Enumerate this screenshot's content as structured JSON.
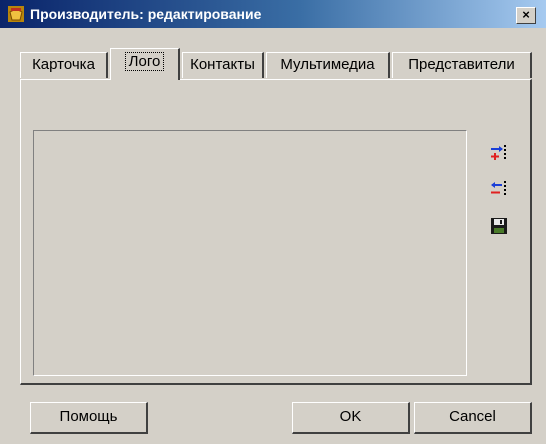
{
  "window": {
    "title": "Производитель: редактирование",
    "close_label": "×"
  },
  "tabs": [
    {
      "label": "Карточка",
      "active": false
    },
    {
      "label": "Лого",
      "active": true
    },
    {
      "label": "Контакты",
      "active": false
    },
    {
      "label": "Мультимедиа",
      "active": false
    },
    {
      "label": "Представители",
      "active": false
    }
  ],
  "toolbar": {
    "icons": [
      "add-logo-icon",
      "remove-logo-icon",
      "save-disk-icon"
    ]
  },
  "buttons": {
    "help": "Помощь",
    "ok": "OK",
    "cancel": "Cancel"
  },
  "colors": {
    "dialog_bg": "#d4d0c8",
    "title_gradient_start": "#0a246a",
    "title_gradient_end": "#a6caf0",
    "icon_blue": "#1a3fd8",
    "icon_red": "#e02020"
  }
}
